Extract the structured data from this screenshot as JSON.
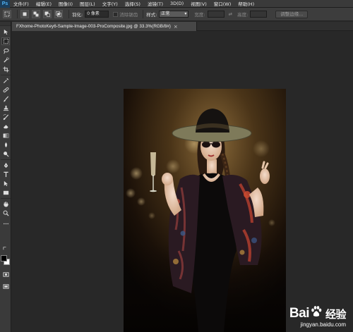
{
  "app": {
    "logo": "Ps",
    "menu": [
      "文件(F)",
      "编辑(E)",
      "图像(I)",
      "图层(L)",
      "文字(Y)",
      "选择(S)",
      "滤镜(T)",
      "3D(D)",
      "视图(V)",
      "窗口(W)",
      "帮助(H)"
    ]
  },
  "options": {
    "feather_label": "羽化:",
    "feather_value": "0 像素",
    "antialias_label": "消除锯齿",
    "style_label": "样式:",
    "style_value": "正常",
    "width_label": "宽度:",
    "height_label": "高度:",
    "refine_button": "调整边缘..."
  },
  "document": {
    "tab_title": "FXhome-PhotoKey6-Sample-Image-003-ProComposite.jpg @ 33.3%(RGB/8#)",
    "close_symbol": "×"
  },
  "tools": [
    "move-tool",
    "marquee-tool",
    "lasso-tool",
    "quick-select-tool",
    "crop-tool",
    "eyedropper-tool",
    "healing-tool",
    "brush-tool",
    "stamp-tool",
    "history-brush-tool",
    "eraser-tool",
    "gradient-tool",
    "blur-tool",
    "dodge-tool",
    "pen-tool",
    "type-tool",
    "path-select-tool",
    "shape-tool",
    "hand-tool",
    "zoom-tool"
  ],
  "colors": {
    "foreground": "#000000",
    "background": "#ffffff",
    "ui_bg": "#282828",
    "ui_panel": "#3a3a3a"
  },
  "watermark": {
    "brand_left": "Bai",
    "brand_right": "经验",
    "url": "jingyan.baidu.com"
  }
}
